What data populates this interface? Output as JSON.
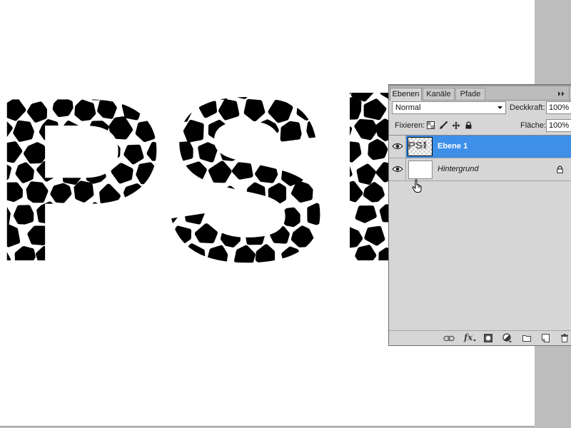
{
  "canvas": {
    "letters": [
      "P",
      "S"
    ],
    "pattern_color": "#000000"
  },
  "layers_panel": {
    "tabs": [
      {
        "label": "Ebenen",
        "active": true
      },
      {
        "label": "Kanäle",
        "active": false
      },
      {
        "label": "Pfade",
        "active": false
      }
    ],
    "collapse_icon": "double-arrow-icon",
    "blend_mode": {
      "selected": "Normal"
    },
    "opacity": {
      "label": "Deckkraft:",
      "value": "100%"
    },
    "lock": {
      "label": "Fixieren:",
      "icons": [
        "lock-transparent-pixels-icon",
        "lock-image-pixels-icon",
        "lock-position-icon",
        "lock-all-icon"
      ]
    },
    "fill": {
      "label": "Fläche:",
      "value": "100%"
    },
    "layers": [
      {
        "name": "Ebene 1",
        "visible": true,
        "selected": true
      },
      {
        "name": "Hintergrund",
        "visible": true,
        "selected": false,
        "locked": true
      }
    ],
    "footer": {
      "fx_label": "fx",
      "icons": [
        "link-layers-icon",
        "layer-style-fx-icon",
        "add-mask-icon",
        "adjustment-layer-icon",
        "new-group-icon",
        "new-layer-icon",
        "delete-layer-icon"
      ]
    }
  },
  "cursor": "pointing-hand-cursor-icon",
  "colors": {
    "selection": "#3d8fe8",
    "panel": "#d6d6d6",
    "workspace": "#bdbdbd",
    "canvas": "#ffffff"
  }
}
